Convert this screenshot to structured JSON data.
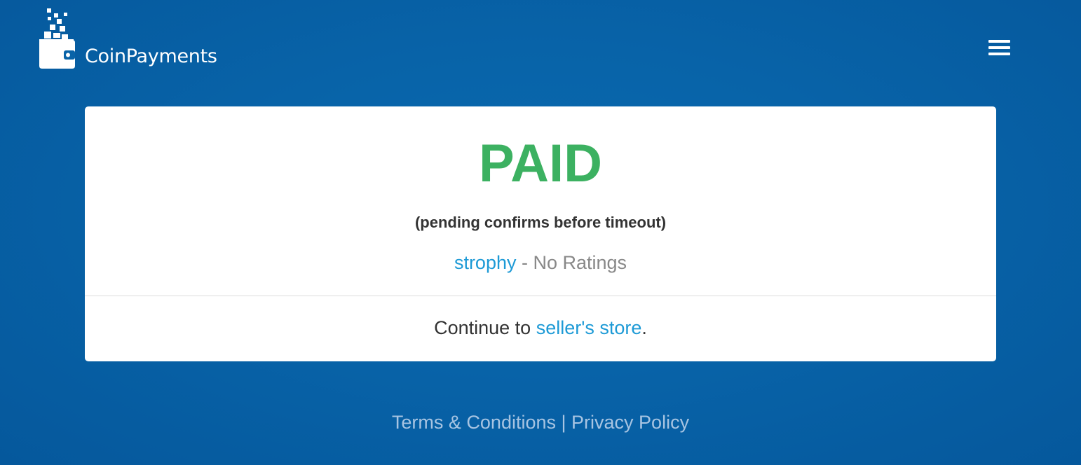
{
  "header": {
    "brand_name": "CoinPayments",
    "logo_icon": "wallet-icon",
    "menu_icon": "hamburger-menu-icon"
  },
  "status": {
    "title": "PAID",
    "note": "(pending confirms before timeout)"
  },
  "seller": {
    "name": "strophy",
    "separator": " - ",
    "rating_text": "No Ratings"
  },
  "continue": {
    "prefix": "Continue to ",
    "link_text": "seller's store",
    "suffix": "."
  },
  "footer": {
    "terms_label": "Terms & Conditions",
    "separator": " | ",
    "privacy_label": "Privacy Policy"
  },
  "colors": {
    "background": "#0863a8",
    "paid_green": "#3cb161",
    "link_blue": "#1d9ad6",
    "footer_text": "#a7c4e2"
  }
}
